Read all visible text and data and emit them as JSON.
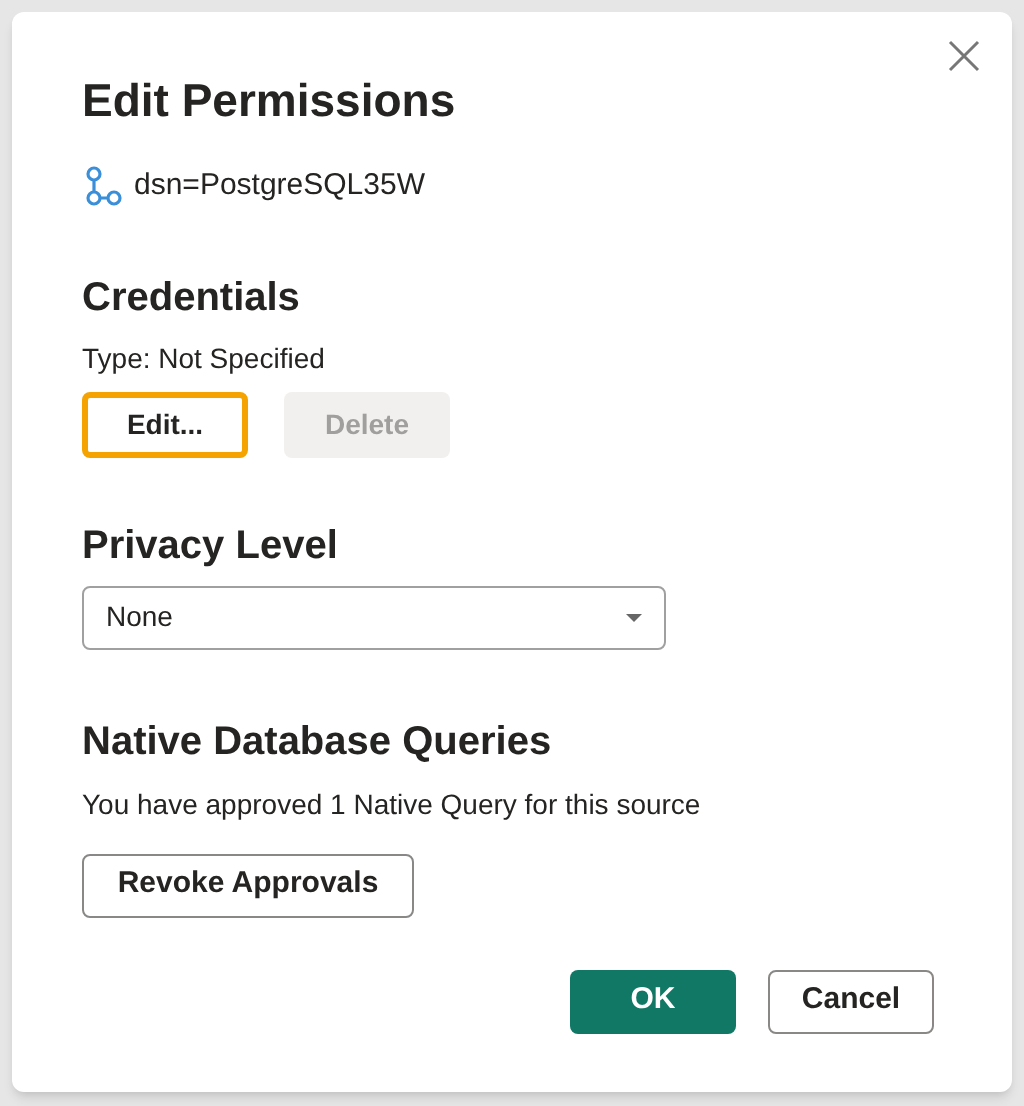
{
  "dialog": {
    "title": "Edit Permissions",
    "source": "dsn=PostgreSQL35W"
  },
  "credentials": {
    "heading": "Credentials",
    "type_text": "Type: Not Specified",
    "buttons": [
      {
        "label": "Edit...",
        "focused": true,
        "disabled": false
      },
      {
        "label": "Delete",
        "focused": false,
        "disabled": true
      }
    ]
  },
  "privacy": {
    "heading": "Privacy Level",
    "value": "None"
  },
  "native_queries": {
    "heading": "Native Database Queries",
    "text": "You have approved 1 Native Query for this source",
    "button": "Revoke Approvals"
  },
  "footer_buttons": [
    {
      "label": "OK",
      "kind": "primary"
    },
    {
      "label": "Cancel",
      "kind": "secondary"
    }
  ]
}
